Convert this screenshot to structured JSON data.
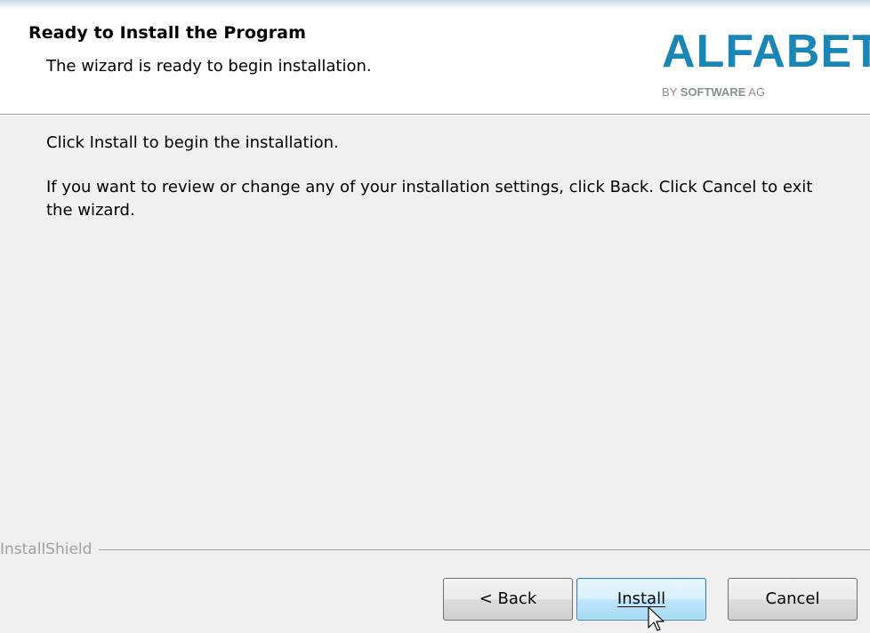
{
  "header": {
    "title": "Ready to Install the Program",
    "subtitle": "The wizard is ready to begin installation.",
    "logo": {
      "main": "ALFABET",
      "sub_prefix": "BY ",
      "sub_strong": "SOFTWARE",
      "sub_suffix": " AG",
      "color": "#1a86b5"
    }
  },
  "body": {
    "line1": "Click Install to begin the installation.",
    "line2": "If you want to review or change any of your installation settings, click Back. Click Cancel to exit the wizard."
  },
  "footer": {
    "brand_label": "InstallShield"
  },
  "buttons": {
    "back": "< Back",
    "install": "Install",
    "cancel": "Cancel"
  }
}
